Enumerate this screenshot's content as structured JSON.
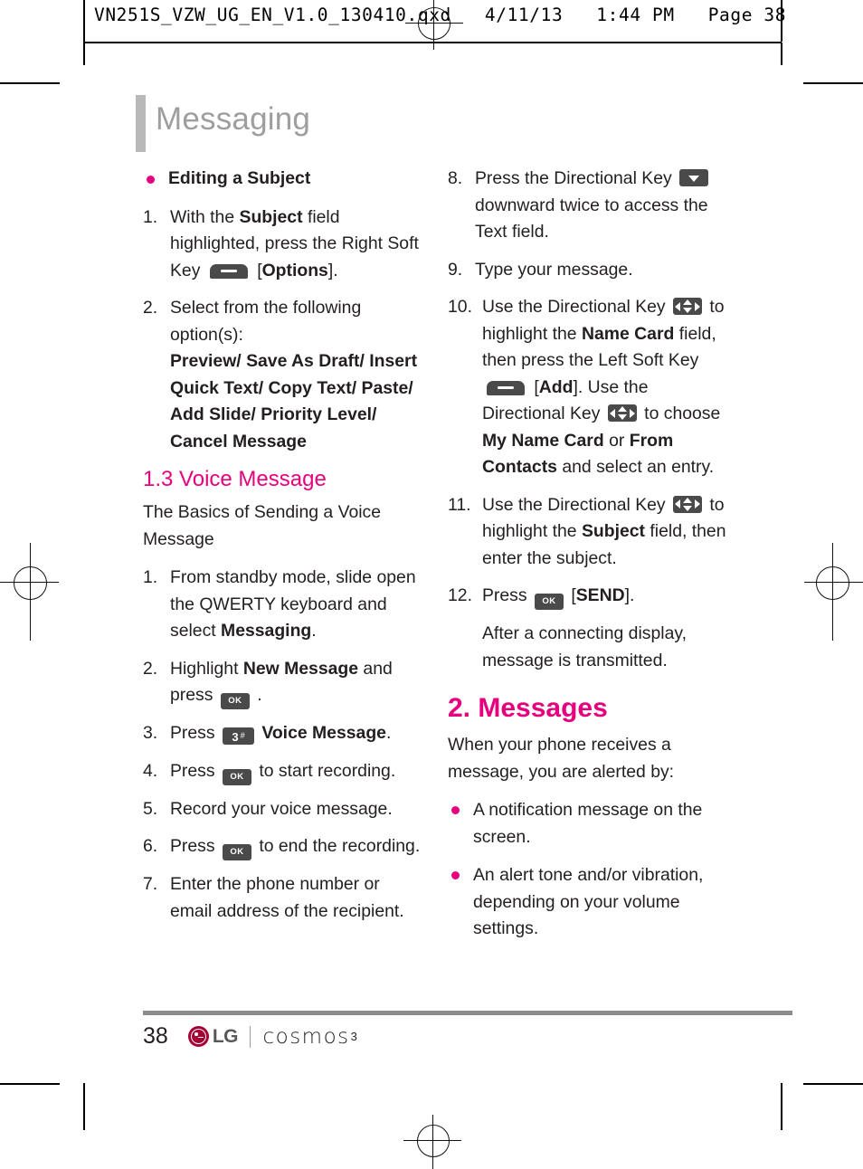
{
  "prepress": {
    "header_text": "VN251S_VZW_UG_EN_V1.0_130410.qxd   4/11/13   1:44 PM   Page 38"
  },
  "page": {
    "chapter_title": "Messaging",
    "page_number": "38",
    "brand": {
      "lg_label": "LG",
      "model": "cosmos",
      "model_superscript": "3"
    },
    "accent_color": "#e6007e",
    "title_color": "#9e9e9e"
  },
  "icons": {
    "soft_key": "soft-key-icon",
    "ok_key": "OK",
    "key_3": "3",
    "key_hash": "#",
    "down_key": "directional-key-down-icon",
    "nav_key": "directional-key-4way-icon"
  },
  "left_column": {
    "bullet_heading": "Editing a Subject",
    "step1": {
      "num": "1.",
      "t1": "With the ",
      "b1": "Subject",
      "t2": " field highlighted, press the Right Soft Key ",
      "t3": " [",
      "b2": "Options",
      "t4": "]."
    },
    "step2": {
      "num": "2.",
      "t1": "Select from the following option(s):",
      "options": "Preview/ Save As Draft/ Insert Quick Text/ Copy Text/ Paste/ Add Slide/ Priority Level/ Cancel Message"
    },
    "section_heading": "1.3 Voice Message",
    "section_intro": "The Basics of Sending a Voice Message",
    "v1": {
      "num": "1.",
      "t1": "From standby mode, slide open the QWERTY keyboard and select ",
      "b1": "Messaging",
      "t2": "."
    },
    "v2": {
      "num": "2.",
      "t1": "Highlight ",
      "b1": "New Message",
      "t2": " and press ",
      "t3": " ."
    },
    "v3": {
      "num": "3.",
      "t1": "Press ",
      "t2": "  ",
      "b1": "Voice Message",
      "t3": "."
    },
    "v4": {
      "num": "4.",
      "t1": "Press ",
      "t2": " to start recording."
    },
    "v5": {
      "num": "5.",
      "t1": "Record your voice message."
    },
    "v6": {
      "num": "6.",
      "t1": "Press ",
      "t2": " to end the recording."
    },
    "v7": {
      "num": "7.",
      "t1": "Enter the phone number or email address of the recipient."
    }
  },
  "right_column": {
    "v8": {
      "num": "8.",
      "t1": "Press the Directional Key ",
      "t2": " downward twice to access the Text field."
    },
    "v9": {
      "num": "9.",
      "t1": "Type your message."
    },
    "v10": {
      "num": "10.",
      "t1": "Use the Directional Key ",
      "t2": "  to highlight the ",
      "b1": "Name Card",
      "t3": " field, then press the Left Soft  Key ",
      "t4": " [",
      "b2": "Add",
      "t5": "]. Use the Directional Key ",
      "t6": "  to choose ",
      "b3": "My Name Card",
      "t7": " or ",
      "b4": "From Contacts",
      "t8": " and select an entry."
    },
    "v11": {
      "num": "11.",
      "t1": "Use the Directional Key ",
      "t2": "  to highlight the ",
      "b1": "Subject",
      "t3": " field, then enter the subject."
    },
    "v12": {
      "num": "12.",
      "t1": "Press ",
      "t2": "  [",
      "b1": "SEND",
      "t3": "].",
      "followup": "After a connecting display, message is transmitted."
    },
    "section_heading": "2. Messages",
    "section_intro": "When your phone receives a message, you are alerted by:",
    "bullet1": "A notification message on the screen.",
    "bullet2": "An alert tone and/or vibration, depending on your volume settings."
  }
}
